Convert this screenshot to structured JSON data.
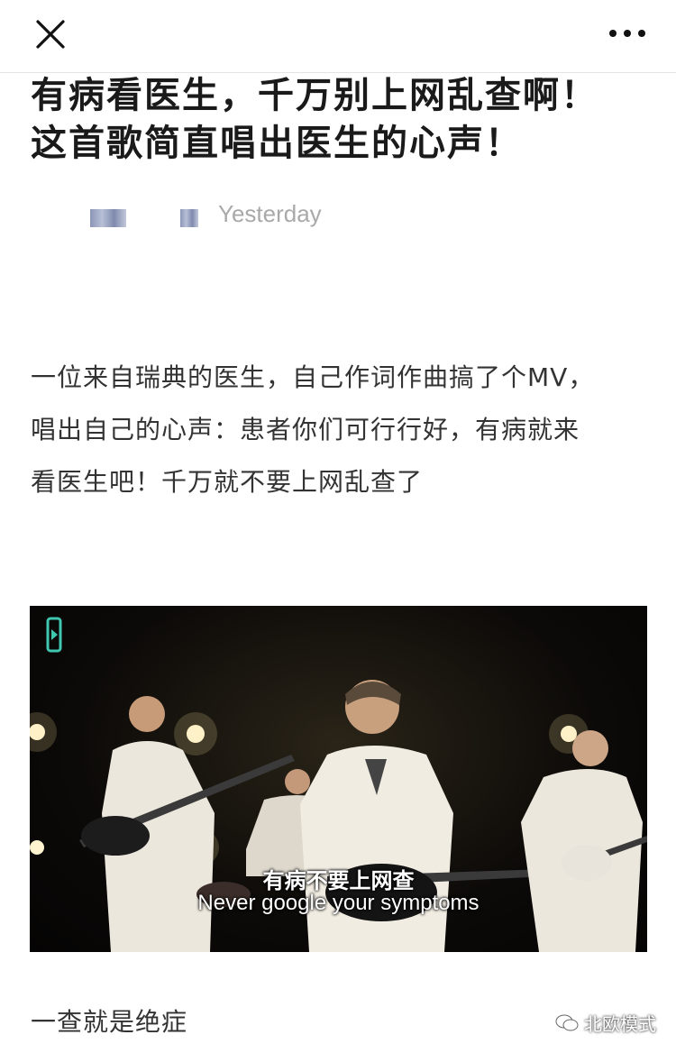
{
  "topbar": {
    "close_icon": "close-icon",
    "more_icon": "more-dots-icon"
  },
  "article": {
    "title_lines": [
      "有病看医生，千万别上网乱查啊！",
      "这首歌简直唱出医生的心声！"
    ],
    "date": "Yesterday",
    "intro_lines": [
      "一位来自瑞典的医生，自己作词作曲搞了个MV，",
      "唱出自己的心声：患者你们可行行好，有病就来",
      "看医生吧！千万就不要上网乱查了"
    ],
    "video": {
      "subtitle_zh": "有病不要上网查",
      "subtitle_en": "Never google your symptoms"
    },
    "after_video": "一查就是绝症",
    "watermark": "北欧模式"
  },
  "colors": {
    "title": "#1a1a1a",
    "body_text": "#333333",
    "meta_gray": "#a9a9a9",
    "video_bg": "#0c0a08"
  }
}
